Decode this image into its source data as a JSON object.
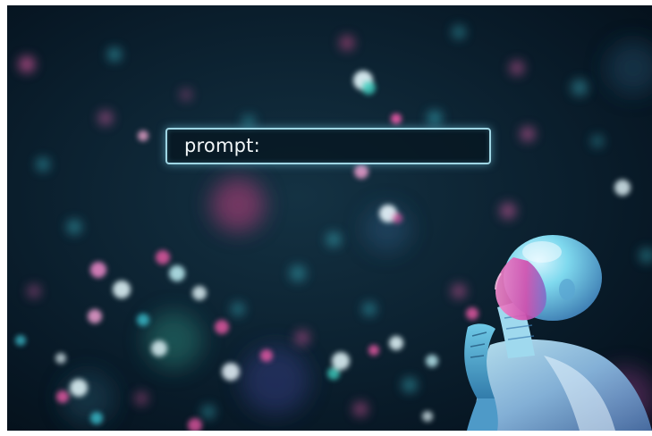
{
  "prompt_field": {
    "label": "prompt:"
  },
  "palette": {
    "background": "#0c2231",
    "bokeh_pink": "#e85aa6",
    "bokeh_cyan": "#3fc9d8",
    "bokeh_white": "#e8fbff",
    "box_border": "#9fd6e4",
    "robot_cyan": "#7fd9ee",
    "robot_magenta": "#d24fae"
  },
  "icons": {
    "robot": "humanoid-robot-figure"
  }
}
